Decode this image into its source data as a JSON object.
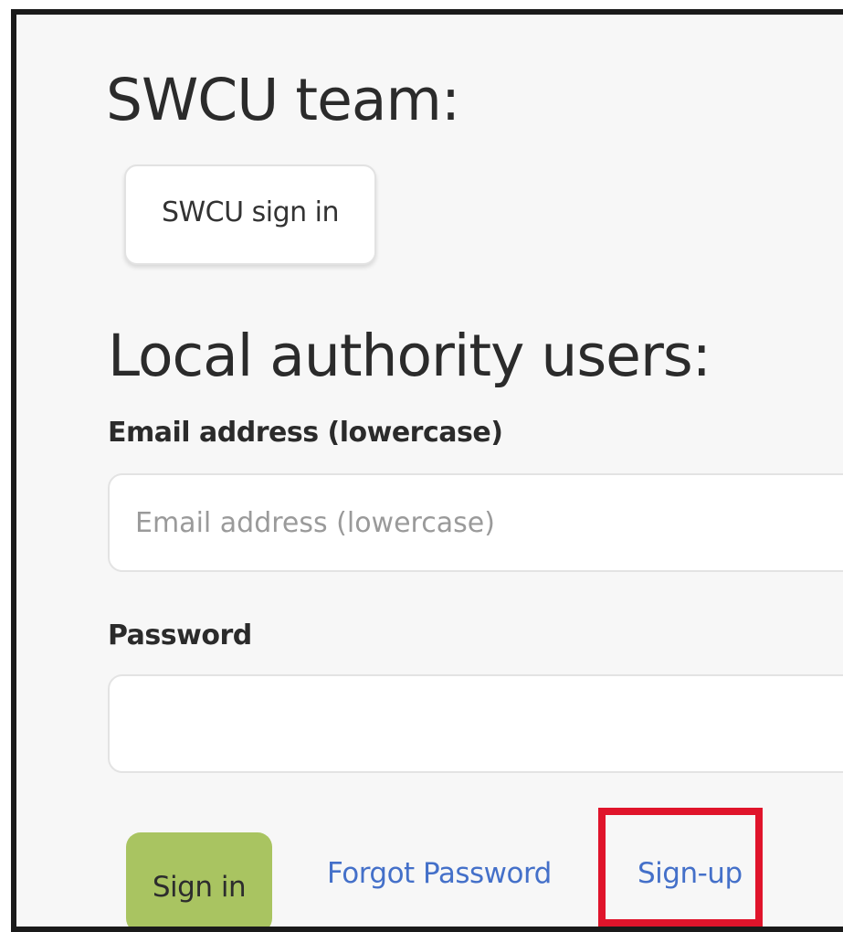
{
  "team_section": {
    "heading": "SWCU team:",
    "signin_button_label": "SWCU sign in"
  },
  "local_section": {
    "heading": "Local authority users:",
    "email": {
      "label": "Email address (lowercase)",
      "placeholder": "Email address (lowercase)",
      "value": ""
    },
    "password": {
      "label": "Password",
      "value": ""
    },
    "signin_button_label": "Sign in",
    "forgot_password_link": "Forgot Password",
    "signup_link": "Sign-up"
  },
  "colors": {
    "signin_button_bg": "#a9c461",
    "link_color": "#4470c9",
    "highlight_border": "#e0142b"
  }
}
